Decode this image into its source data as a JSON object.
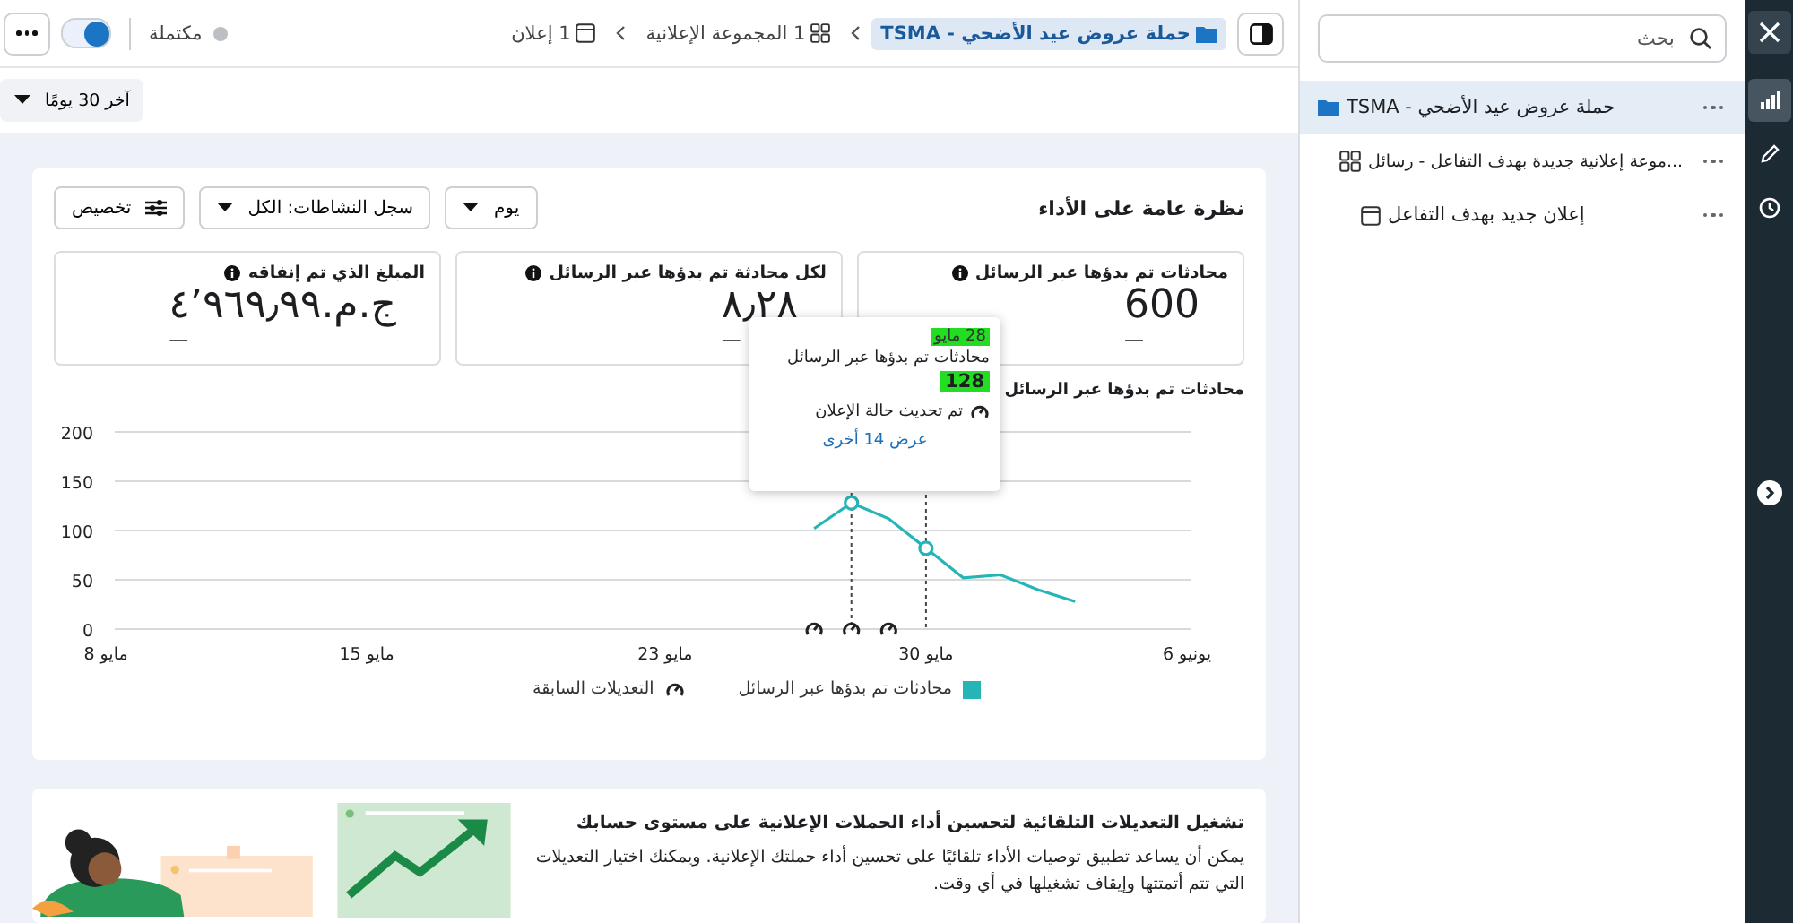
{
  "rail": {
    "buttons": [
      {
        "selected": false
      },
      {
        "selected": true
      },
      {
        "selected": false
      },
      {
        "selected": false
      }
    ]
  },
  "navigator": {
    "search": {
      "placeholder": "بحث"
    },
    "tree": [
      {
        "label": "حملة عروض عيد الأضحي - TSMA",
        "selected": true,
        "children": [
          {
            "label": "...موعة إعلانية جديدة بهدف التفاعل - رسائل",
            "selected": false,
            "children": [
              {
                "label": "إعلان جديد بهدف التفاعل",
                "selected": false
              }
            ]
          }
        ]
      }
    ]
  },
  "toolbar": {
    "breadcrumb": [
      {
        "label": "حملة عروض عيد الأضحي - TSMA",
        "selected": true
      },
      {
        "label": "1 المجموعة الإعلانية",
        "selected": false
      },
      {
        "label": "1 إعلان",
        "selected": false
      }
    ],
    "status": "مكتملة",
    "on": true,
    "date_range": "آخر 30 يومًا"
  },
  "overview": {
    "title": "نظرة عامة على الأداء",
    "period": "يوم",
    "activity": "سجل النشاطات: الكل",
    "customize": "تخصيص",
    "metrics": [
      {
        "label": "محادثات تم بدؤها عبر الرسائل",
        "value": "600",
        "change": "—"
      },
      {
        "label": "لكل محادثة تم بدؤها عبر الرسائل",
        "value": "٨٫٢٨",
        "change": "—"
      },
      {
        "label": "المبلغ الذي تم إنفاقه",
        "value": "ج.م.٤٬٩٦٩٫٩٩",
        "change": "—"
      }
    ],
    "chart_data": {
      "type": "line",
      "title": "محادثات تم بدؤها عبر الرسائل",
      "categories": [
        "8 مايو",
        null,
        null,
        null,
        null,
        null,
        null,
        "15 مايو",
        null,
        null,
        null,
        null,
        null,
        null,
        null,
        "23 مايو",
        null,
        null,
        null,
        null,
        null,
        null,
        "30 مايو",
        null,
        null,
        null,
        null,
        null,
        null,
        "6 يونيو"
      ],
      "series": [
        {
          "name": "محادثات تم بدؤها عبر الرسائل",
          "color": "#25b5b7",
          "values": [
            null,
            null,
            null,
            null,
            null,
            null,
            null,
            null,
            null,
            null,
            null,
            null,
            null,
            null,
            null,
            null,
            null,
            null,
            null,
            102,
            128,
            112,
            82,
            52,
            55,
            40,
            28,
            null,
            null,
            null
          ]
        }
      ],
      "ylim": [
        0,
        200
      ],
      "yticks": [
        0,
        50,
        100,
        150,
        200
      ],
      "grid": true
    },
    "change_markers": [
      {
        "kind": "gauge"
      },
      {
        "kind": "gauge"
      },
      {
        "kind": "gauge"
      }
    ],
    "legend_changes": "التعديلات السابقة",
    "tooltip": {
      "date": "28 مايو",
      "metric": "محادثات تم بدؤها عبر الرسائل",
      "value": "128",
      "event": "تم تحديث حالة الإعلان",
      "link": "عرض 14 أخرى",
      "highlighted": true
    }
  },
  "promo": {
    "title": "تشغيل التعديلات التلقائية لتحسين أداء الحملات الإعلانية على مستوى حسابك",
    "body": "يمكن أن يساعد تطبيق توصيات الأداء تلقائيًا على تحسين أداء حملتك الإعلانية. ويمكنك اختيار التعديلات التي تتم أتمتتها وإيقاف تشغيلها في أي وقت."
  }
}
